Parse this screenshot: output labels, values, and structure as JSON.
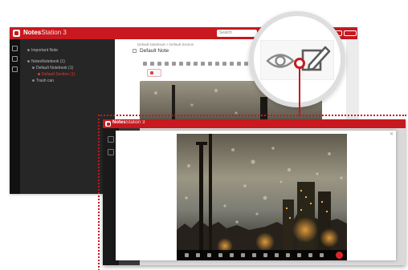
{
  "app": {
    "name_bold": "Notes",
    "name_light": "Station 3",
    "search_placeholder": "Search",
    "accent_color": "#c7191f"
  },
  "sidebar": {
    "items": [
      {
        "label": "Important Note",
        "active": false
      },
      {
        "label": "NotesNotebook (1)",
        "active": false
      },
      {
        "label": "Default Notebook (1)",
        "active": false
      },
      {
        "label": "Default Section (1)",
        "active": true
      },
      {
        "label": "Trash can",
        "active": false
      }
    ]
  },
  "editor": {
    "breadcrumb": "Default Notebook  >  Default Section",
    "note_title": "Default Note"
  },
  "viewer": {
    "close_label": "✕"
  },
  "magnifier": {
    "icons": [
      "eye-icon",
      "edit-note-icon"
    ]
  }
}
